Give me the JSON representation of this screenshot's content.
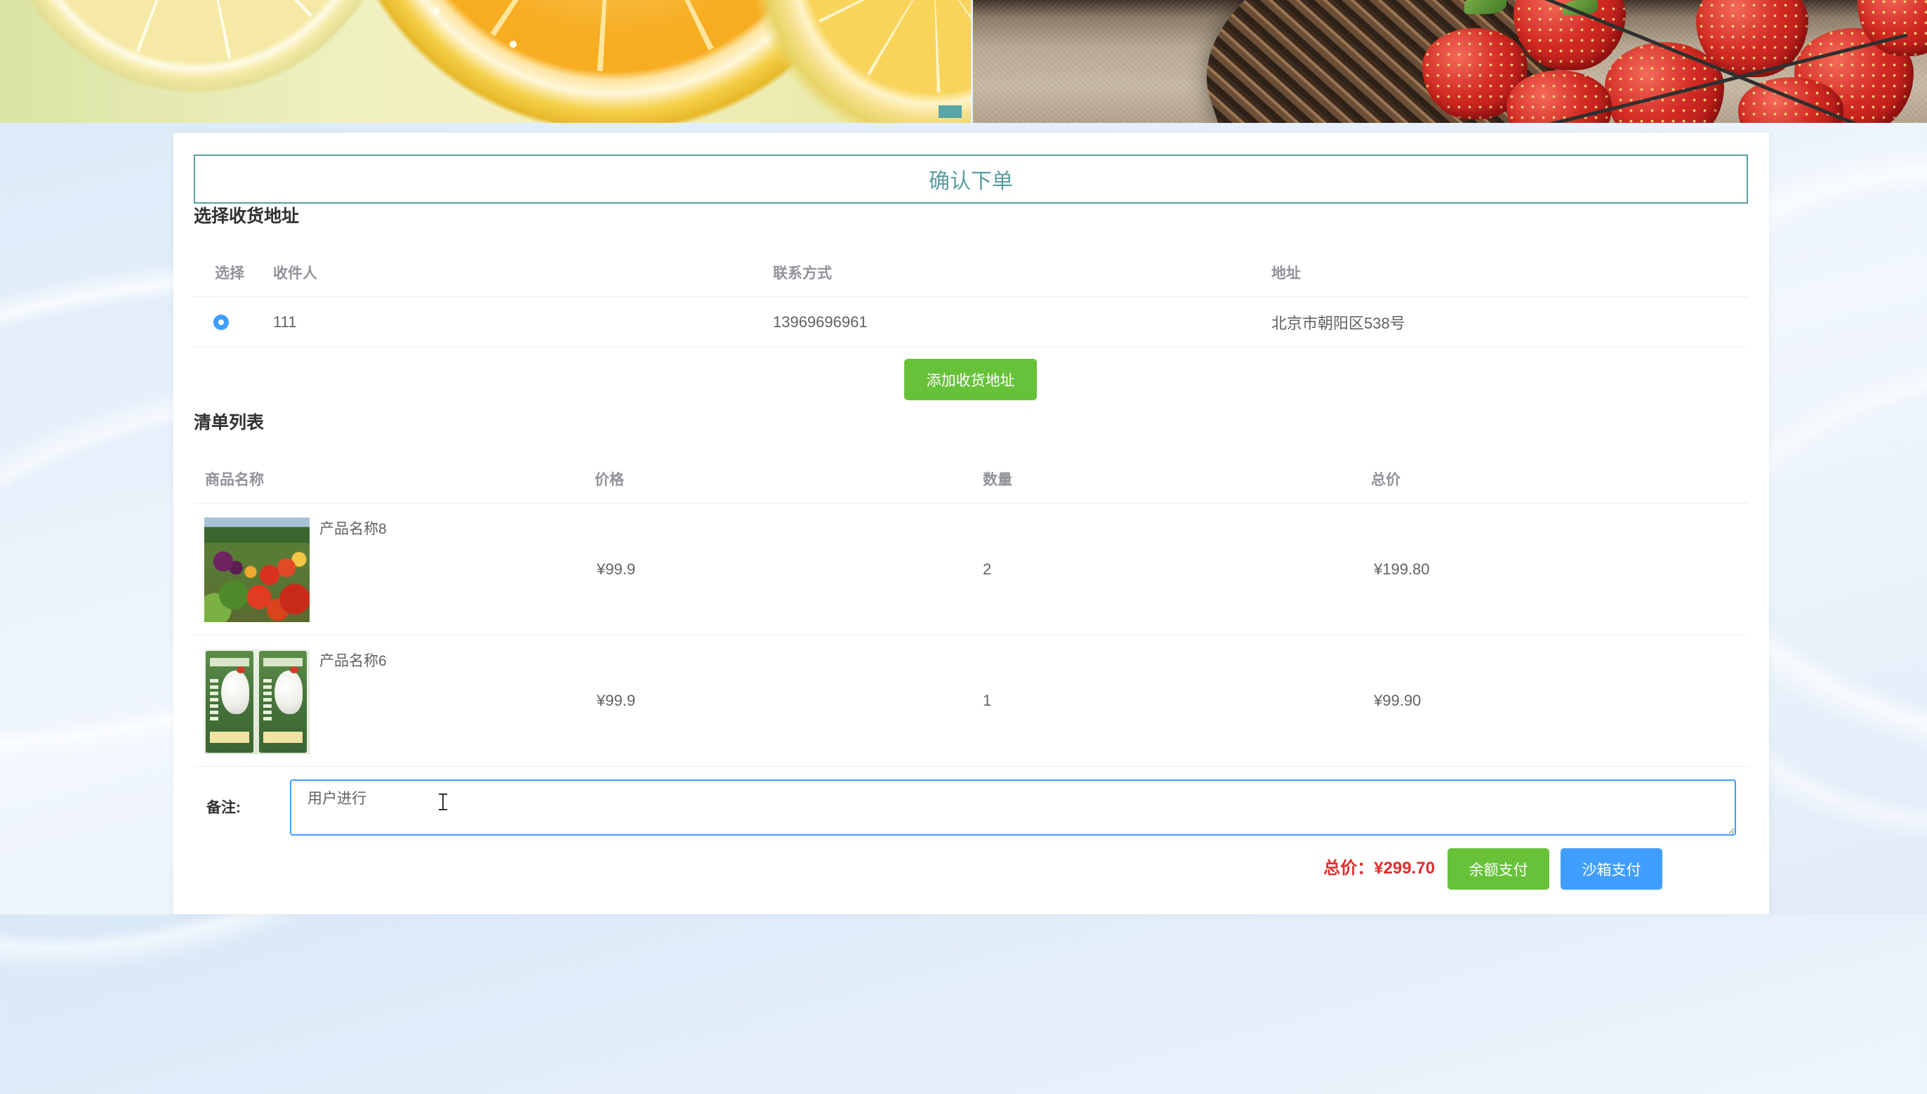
{
  "title": "确认下单",
  "address_section": {
    "heading": "选择收货地址",
    "columns": [
      "选择",
      "收件人",
      "联系方式",
      "地址"
    ],
    "rows": [
      {
        "selected": true,
        "receiver": "111",
        "phone": "13969696961",
        "address": "北京市朝阳区538号"
      }
    ],
    "add_button": "添加收货地址"
  },
  "order_section": {
    "heading": "清单列表",
    "columns": [
      "商品名称",
      "价格",
      "数量",
      "总价"
    ],
    "items": [
      {
        "image_icon": "vegetables-photo",
        "name": "产品名称8",
        "price": "¥99.9",
        "quantity": "2",
        "subtotal": "¥199.80"
      },
      {
        "image_icon": "chicken-package-photo",
        "name": "产品名称6",
        "price": "¥99.9",
        "quantity": "1",
        "subtotal": "¥99.90"
      }
    ]
  },
  "remark": {
    "label": "备注:",
    "value": "用户进行"
  },
  "summary": {
    "total_label": "总价：",
    "total_value": "¥299.70"
  },
  "payment_buttons": {
    "balance": "余额支付",
    "sandbox": "沙箱支付"
  },
  "colors": {
    "title_accent": "#5a9ea0",
    "success": "#67c23a",
    "primary": "#409eff",
    "price": "#e02d2d"
  }
}
